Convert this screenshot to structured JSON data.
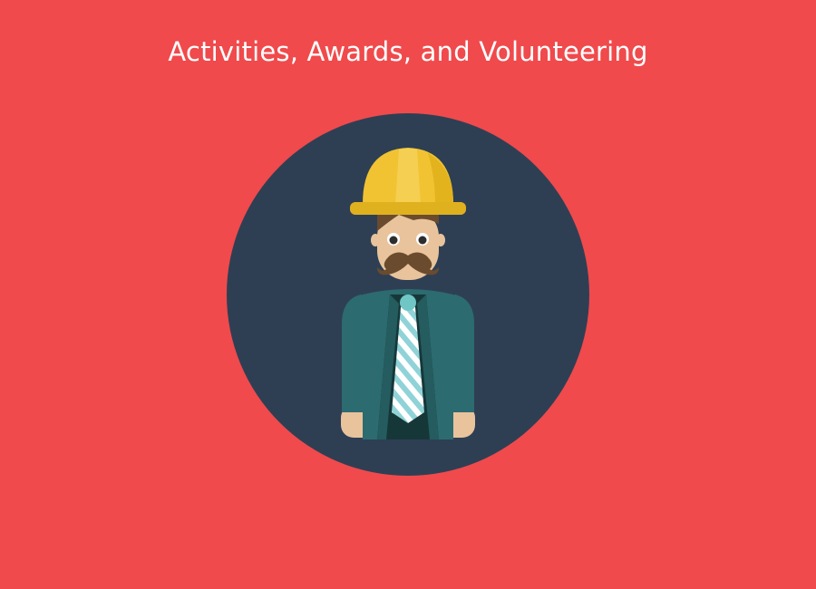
{
  "page": {
    "title": "Activities, Awards, and Volunteering",
    "background_color": "#f04a4c",
    "text_color": "#ffffff"
  },
  "illustration": {
    "icon": "construction-worker-avatar-icon",
    "circle_color": "#2e3f54",
    "helmet_color": "#f1c232",
    "jacket_color": "#2c6b70",
    "skin_color": "#e8c39c",
    "tie_color": "#a5dce0"
  }
}
